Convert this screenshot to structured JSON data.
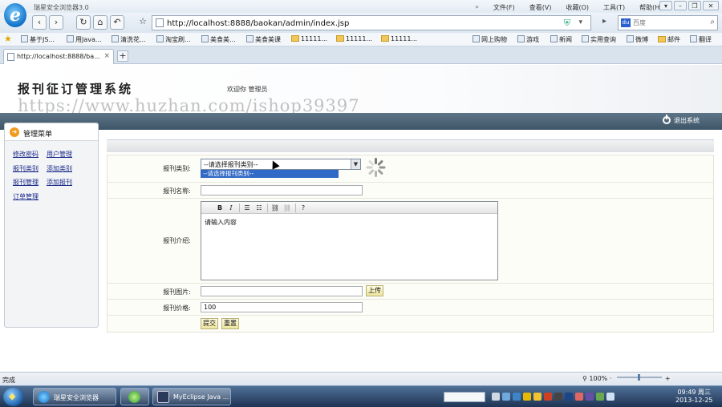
{
  "browser": {
    "window_title": "瑞星安全浏览器3.0",
    "menu": [
      "文件(F)",
      "查看(V)",
      "收藏(O)",
      "工具(T)",
      "帮助(H)"
    ],
    "url": "http://localhost:8888/baokan/admin/index.jsp",
    "search_placeholder": "百度",
    "favorites": [
      {
        "label": "基于JS...",
        "kind": "page"
      },
      {
        "label": "用Java...",
        "kind": "page"
      },
      {
        "label": "清洗花...",
        "kind": "page"
      },
      {
        "label": "淘宝刷...",
        "kind": "page"
      },
      {
        "label": "美食美...",
        "kind": "page"
      },
      {
        "label": "美食美课",
        "kind": "page"
      },
      {
        "label": "11111...",
        "kind": "folder"
      },
      {
        "label": "11111...",
        "kind": "folder"
      },
      {
        "label": "11111...",
        "kind": "folder"
      },
      {
        "label": "网上购物",
        "kind": "page"
      },
      {
        "label": "游戏",
        "kind": "page"
      },
      {
        "label": "新闻",
        "kind": "page"
      },
      {
        "label": "实用查询",
        "kind": "page"
      },
      {
        "label": "微博",
        "kind": "page"
      },
      {
        "label": "邮件",
        "kind": "folder"
      },
      {
        "label": "翻译",
        "kind": "page"
      }
    ],
    "tab_label": "http://localhost:8888/ba...",
    "status_text": "完成",
    "zoom": "100%"
  },
  "page": {
    "system_title": "报刊征订管理系统",
    "welcome": "欢迎你 管理员",
    "watermark": "https://www.huzhan.com/ishop39397",
    "logout": "退出系统",
    "sidebar": {
      "title": "管理菜单",
      "links": [
        "修改密码",
        "用户管理",
        "报刊类别",
        "添加类别",
        "报刊管理",
        "添加报刊",
        "订单管理"
      ]
    },
    "form": {
      "category_label": "报刊类别:",
      "category_selected": "--请选择报刊类别--",
      "category_option_highlighted": "--请选择报刊类别--",
      "name_label": "报刊名称:",
      "name_value": "",
      "intro_label": "报刊介绍:",
      "intro_placeholder": "请输入内容",
      "image_label": "报刊图片:",
      "upload_button": "上传",
      "price_label": "报刊价格:",
      "price_value": "100",
      "submit_button": "提交",
      "reset_button": "重置"
    }
  },
  "taskbar": {
    "tasks": [
      "瑞星安全浏览器",
      "",
      "MyEclipse Java ..."
    ],
    "clock_time": "09:49 周三",
    "clock_date": "2013-12-25"
  },
  "colors": {
    "band": "#3e5568",
    "link": "#1b2a8a",
    "highlight": "#3169c6"
  }
}
